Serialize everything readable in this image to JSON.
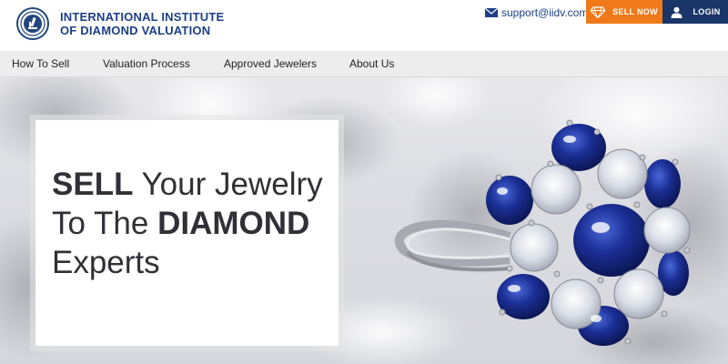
{
  "brand": {
    "name_line1": "INTERNATIONAL INSTITUTE",
    "name_line2": "OF DIAMOND VALUATION",
    "logo_icon": "microscope-seal-icon"
  },
  "header": {
    "email": "support@iidv.com",
    "email_icon": "envelope-icon",
    "sell_now_label": "SELL NOW",
    "sell_icon": "diamond-icon",
    "login_label": "LOGIN",
    "login_icon": "user-icon"
  },
  "nav": {
    "items": [
      {
        "label": "How To Sell"
      },
      {
        "label": "Valuation Process"
      },
      {
        "label": "Approved Jewelers"
      },
      {
        "label": "About Us"
      }
    ]
  },
  "hero": {
    "line1_bold": "SELL",
    "line1_rest": " Your Jewelry",
    "line2_rest": "To The ",
    "line2_bold": "DIAMOND",
    "line3": "Experts",
    "image": "sapphire-diamond-cluster-ring"
  },
  "colors": {
    "brand_blue": "#1d3f86",
    "sell_orange": "#f07a1a",
    "login_navy": "#1a3567",
    "nav_bg": "#eeedee"
  }
}
